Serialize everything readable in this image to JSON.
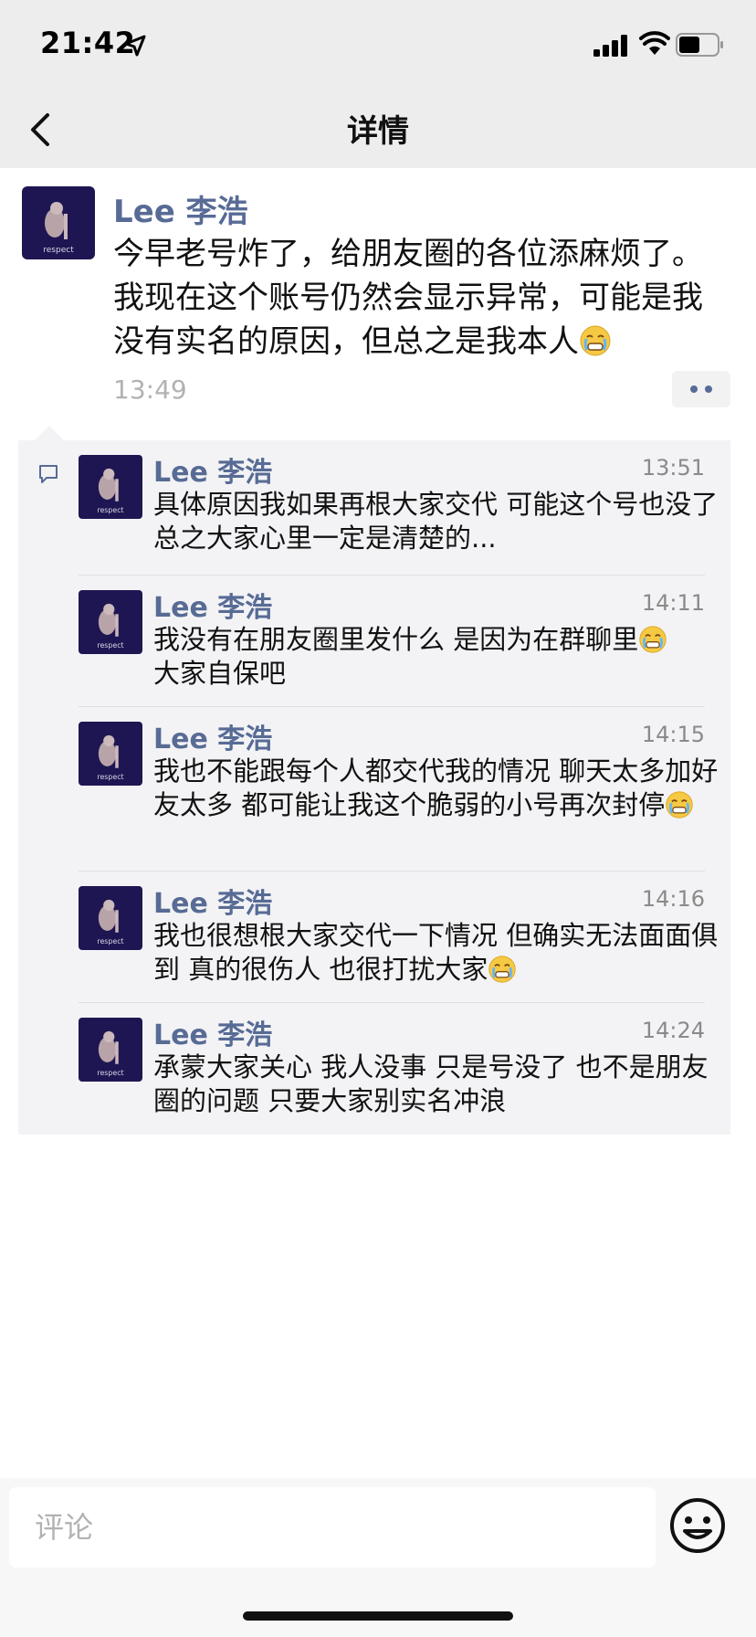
{
  "status_bar": {
    "time": "21:42"
  },
  "nav": {
    "title": "详情"
  },
  "post": {
    "author": "Lee 李浩",
    "text": "今早老号炸了，给朋友圈的各位添麻烦了。我现在这个账号仍然会显示异常，可能是我没有实名的原因，但总之是我本人",
    "time": "13:49",
    "avatar_caption": "respect"
  },
  "comments": [
    {
      "author": "Lee 李浩",
      "time": "13:51",
      "text": "具体原因我如果再根大家交代 可能这个号也没了 总之大家心里一定是清楚的..."
    },
    {
      "author": "Lee 李浩",
      "time": "14:11",
      "text": "我没有在朋友圈里发什么 是因为在群聊里",
      "text2": "大家自保吧"
    },
    {
      "author": "Lee 李浩",
      "time": "14:15",
      "text": "我也不能跟每个人都交代我的情况 聊天太多加好友太多 都可能让我这个脆弱的小号再次封停"
    },
    {
      "author": "Lee 李浩",
      "time": "14:16",
      "text": "我也很想根大家交代一下情况 但确实无法面面俱到 真的很伤人 也很打扰大家"
    },
    {
      "author": "Lee 李浩",
      "time": "14:24",
      "text": "承蒙大家关心 我人没事 只是号没了 也不是朋友圈的问题 只要大家别实名冲浪"
    }
  ],
  "comment_bar": {
    "placeholder": "评论"
  },
  "colors": {
    "link": "#576b95",
    "background": "#ededed",
    "panel": "#f3f3f5"
  },
  "icons": [
    "location-arrow-icon",
    "signal-icon",
    "wifi-icon",
    "battery-icon",
    "back-chevron-icon",
    "comment-bubble-icon",
    "crying-emoji-icon",
    "emoji-face-icon"
  ]
}
